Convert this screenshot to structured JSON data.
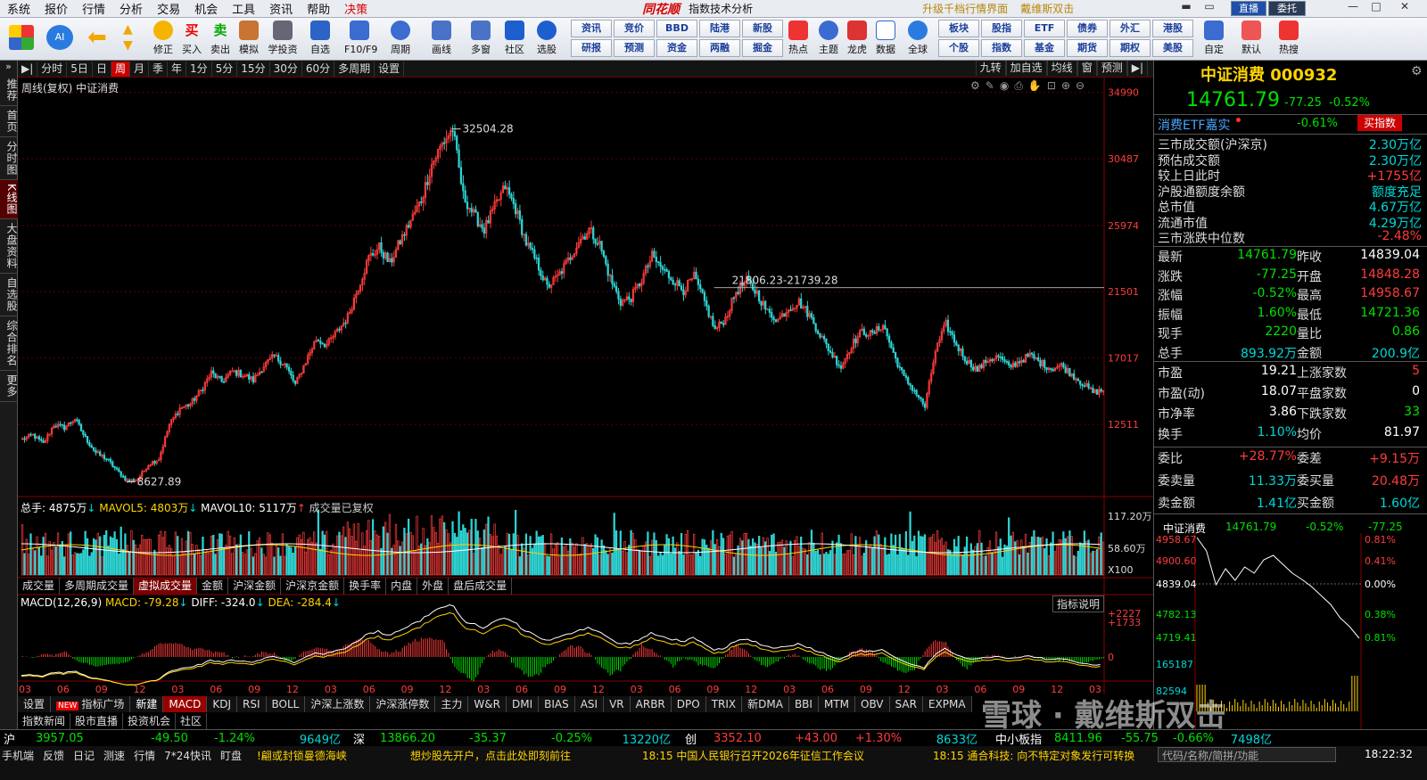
{
  "menu": {
    "items": [
      "系统",
      "报价",
      "行情",
      "分析",
      "交易",
      "机会",
      "工具",
      "资讯",
      "帮助"
    ],
    "decision": "决策",
    "logo": "同花顺",
    "subtitle": "指数技术分析",
    "link1": "升级千档行情界面",
    "link2": "戴维斯双击",
    "live": "直播",
    "broker": "委托"
  },
  "toolbar": {
    "buttons": [
      "修正",
      "买入",
      "卖出",
      "模拟",
      "学投资",
      "自选",
      "F10/F9",
      "周期",
      "画线",
      "多窗",
      "社区",
      "选股"
    ],
    "grid_top": [
      "资讯",
      "竞价",
      "BBD",
      "陆港",
      "新股"
    ],
    "grid_bottom": [
      "研报",
      "预测",
      "资金",
      "两融",
      "掘金"
    ],
    "hot": [
      "热点",
      "主题",
      "龙虎",
      "数据",
      "全球"
    ],
    "grid2_top": [
      "板块",
      "股指",
      "ETF",
      "债券",
      "外汇",
      "港股"
    ],
    "grid2_bottom": [
      "个股",
      "指数",
      "基金",
      "期货",
      "期权",
      "美股"
    ],
    "right": [
      "自定",
      "默认",
      "热搜"
    ]
  },
  "sidetabs": [
    "推荐",
    "首页",
    "分时图",
    "K线图",
    "大盘资料",
    "自选股",
    "综合排名",
    "更多"
  ],
  "timeframes": [
    "分时",
    "5日",
    "日",
    "周",
    "月",
    "季",
    "年",
    "1分",
    "5分",
    "15分",
    "30分",
    "60分",
    "多周期",
    "设置"
  ],
  "timeframes_right": [
    "九转",
    "加自选",
    "均线",
    "窗",
    "预测"
  ],
  "chart_info": "周线(复权)  中证消费",
  "vol_legend": {
    "total": "总手: 4875万",
    "ma5": "MAVOL5: 4803万",
    "ma10": "MAVOL10: 5117万",
    "note": "成交量已复权"
  },
  "macd_legend": {
    "name": "MACD(12,26,9)",
    "macd": "MACD: -79.28",
    "diff": "DIFF: -324.0",
    "dea": "DEA: -284.4",
    "explain": "指标说明"
  },
  "subtabs1": [
    "成交量",
    "多周期成交量",
    "虚拟成交量",
    "金额",
    "沪深金额",
    "沪深京金额",
    "换手率",
    "内盘",
    "外盘",
    "盘后成交量"
  ],
  "idx_tabs": [
    "设置",
    "指标广场",
    "新建",
    "MACD",
    "KDJ",
    "RSI",
    "BOLL",
    "沪深上涨数",
    "沪深涨停数",
    "主力",
    "W&R",
    "DMI",
    "BIAS",
    "ASI",
    "VR",
    "ARBR",
    "DPO",
    "TRIX",
    "新DMA",
    "BBI",
    "MTM",
    "OBV",
    "SAR",
    "EXPMA"
  ],
  "idx_new": "NEW",
  "bottom_tabs": [
    "指数新闻",
    "股市直播",
    "投资机会",
    "社区"
  ],
  "price_axis": [
    "34990",
    "30487",
    "25974",
    "21501",
    "17017",
    "12511"
  ],
  "vol_axis": [
    "117.20万",
    "58.60万",
    "X100"
  ],
  "macd_axis": [
    "+2227",
    "+1733",
    "0"
  ],
  "x_axis": [
    "03",
    "06",
    "09",
    "12",
    "03",
    "06",
    "09",
    "12",
    "03",
    "06",
    "09",
    "12",
    "03",
    "06",
    "09",
    "12",
    "03",
    "06",
    "09",
    "12",
    "03",
    "06",
    "09",
    "12",
    "03",
    "06",
    "09",
    "12",
    "03"
  ],
  "annotations": {
    "high": "32504.28",
    "low": "8627.89",
    "range": "21806.23-21739.28"
  },
  "chart_data": {
    "type": "candlestick",
    "title": "中证消费",
    "period": "周线(复权)",
    "ylim": [
      8000,
      35500
    ],
    "key_points": [
      {
        "label": "high",
        "value": 32504.28
      },
      {
        "label": "low",
        "value": 8627.89
      },
      {
        "label": "last",
        "value": 14761.79
      }
    ],
    "path": [
      11500,
      11800,
      11200,
      12500,
      12300,
      12900,
      11600,
      10600,
      10200,
      9400,
      8700,
      8800,
      9800,
      10200,
      12500,
      13600,
      13900,
      14800,
      16000,
      15400,
      16100,
      15900,
      15500,
      16500,
      17100,
      16600,
      15200,
      16800,
      18300,
      17900,
      18800,
      19800,
      21800,
      23800,
      24500,
      23400,
      24900,
      26300,
      27700,
      30100,
      31500,
      32500,
      28000,
      26700,
      25700,
      27200,
      28600,
      27100,
      24800,
      23500,
      21800,
      22500,
      23600,
      24900,
      25700,
      24700,
      22400,
      20800,
      21100,
      22300,
      23900,
      23000,
      22300,
      21600,
      22500,
      20800,
      18900,
      19700,
      21500,
      22200,
      21400,
      20100,
      19600,
      20400,
      20800,
      19900,
      18600,
      17400,
      16400,
      17900,
      18800,
      18600,
      19300,
      17300,
      15700,
      14800,
      13700,
      17500,
      19300,
      17900,
      16800,
      16200,
      16900,
      17100,
      16400,
      16800,
      17200,
      16700,
      16300,
      16500,
      15900,
      15300,
      14700,
      14800
    ],
    "volume_series": [
      {
        "name": "总手",
        "last": "4875万"
      },
      {
        "name": "MAVOL5",
        "last": "4803万"
      },
      {
        "name": "MAVOL10",
        "last": "5117万"
      }
    ],
    "macd": {
      "params": "12,26,9",
      "macd": -79.28,
      "diff": -324.0,
      "dea": -284.4
    }
  },
  "right": {
    "title": "中证消费 000932",
    "price": "14761.79",
    "change": "-77.25",
    "pct": "-0.52%",
    "etf": "消费ETF嘉实",
    "etf_pct": "-0.61%",
    "etf_btn": "买指数",
    "stats1": [
      {
        "k": "三市成交额(沪深京)",
        "v": "2.30万亿"
      },
      {
        "k": "预估成交额",
        "v": "2.30万亿"
      },
      {
        "k": "较上日此时",
        "v": "+1755亿"
      },
      {
        "k": "沪股通额度余额",
        "v": "额度充足"
      },
      {
        "k": "总市值",
        "v": "4.67万亿"
      },
      {
        "k": "流通市值",
        "v": "4.29万亿"
      },
      {
        "k": "三市涨跌中位数",
        "v": "-2.48%"
      }
    ],
    "quote": [
      {
        "k": "最新",
        "v": "14761.79",
        "k2": "昨收",
        "v2": "14839.04"
      },
      {
        "k": "涨跌",
        "v": "-77.25",
        "k2": "开盘",
        "v2": "14848.28"
      },
      {
        "k": "涨幅",
        "v": "-0.52%",
        "k2": "最高",
        "v2": "14958.67"
      },
      {
        "k": "振幅",
        "v": "1.60%",
        "k2": "最低",
        "v2": "14721.36"
      },
      {
        "k": "现手",
        "v": "2220",
        "k2": "量比",
        "v2": "0.86"
      },
      {
        "k": "总手",
        "v": "893.92万",
        "k2": "金额",
        "v2": "200.9亿"
      }
    ],
    "funda": [
      {
        "k": "市盈",
        "v": "19.21",
        "k2": "上涨家数",
        "v2": "5"
      },
      {
        "k": "市盈(动)",
        "v": "18.07",
        "k2": "平盘家数",
        "v2": "0"
      },
      {
        "k": "市净率",
        "v": "3.86",
        "k2": "下跌家数",
        "v2": "33"
      },
      {
        "k": "换手",
        "v": "1.10%",
        "k2": "均价",
        "v2": "81.97"
      }
    ],
    "order": [
      {
        "k": "委比",
        "v": "+28.77%",
        "k2": "委差",
        "v2": "+9.15万"
      },
      {
        "k": "委卖量",
        "v": "11.33万",
        "k2": "委买量",
        "v2": "20.48万"
      },
      {
        "k": "卖金额",
        "v": "1.41亿",
        "k2": "买金额",
        "v2": "1.60亿"
      }
    ],
    "mini": {
      "name": "中证消费",
      "price": "14761.79",
      "pct": "-0.52%",
      "chg": "-77.25",
      "yl": [
        "4958.67",
        "4900.60",
        "4839.04",
        "4782.13",
        "4719.41",
        "165187",
        "82594"
      ],
      "yr": [
        "0.81%",
        "0.41%",
        "0.00%",
        "0.38%",
        "0.81%"
      ]
    }
  },
  "market": {
    "sh": "沪",
    "sh_v": "3957.05",
    "sh_c": "-49.50",
    "sh_p": "-1.24%",
    "sh_a": "9649亿",
    "sz": "深",
    "sz_v": "13866.20",
    "sz_c": "-35.37",
    "sz_p": "-0.25%",
    "sz_a": "13220亿",
    "cy": "创",
    "cy_v": "3352.10",
    "cy_c": "+43.00",
    "cy_p": "+1.30%",
    "cy_a": "8633亿",
    "zx": "中小板指",
    "zx_v": "8411.96",
    "zx_c": "-55.75",
    "zx_p": "-0.66%",
    "zx_a": "7498亿"
  },
  "status": {
    "items": [
      "手机端",
      "反馈",
      "日记",
      "测速",
      "行情",
      "7*24快讯",
      "盯盘"
    ],
    "news1": "!翩或封锁曼德海峡",
    "news2": "想炒股先开户，点击此处即刻前往",
    "news3": "18:15 中国人民银行召开2026年征信工作会议",
    "news4": "18:15 通合科技: 向不特定对象发行可转换",
    "search": "代码/名称/简拼/功能",
    "time": "18:22:32"
  },
  "watermark": "雪球 · 戴维斯双击"
}
